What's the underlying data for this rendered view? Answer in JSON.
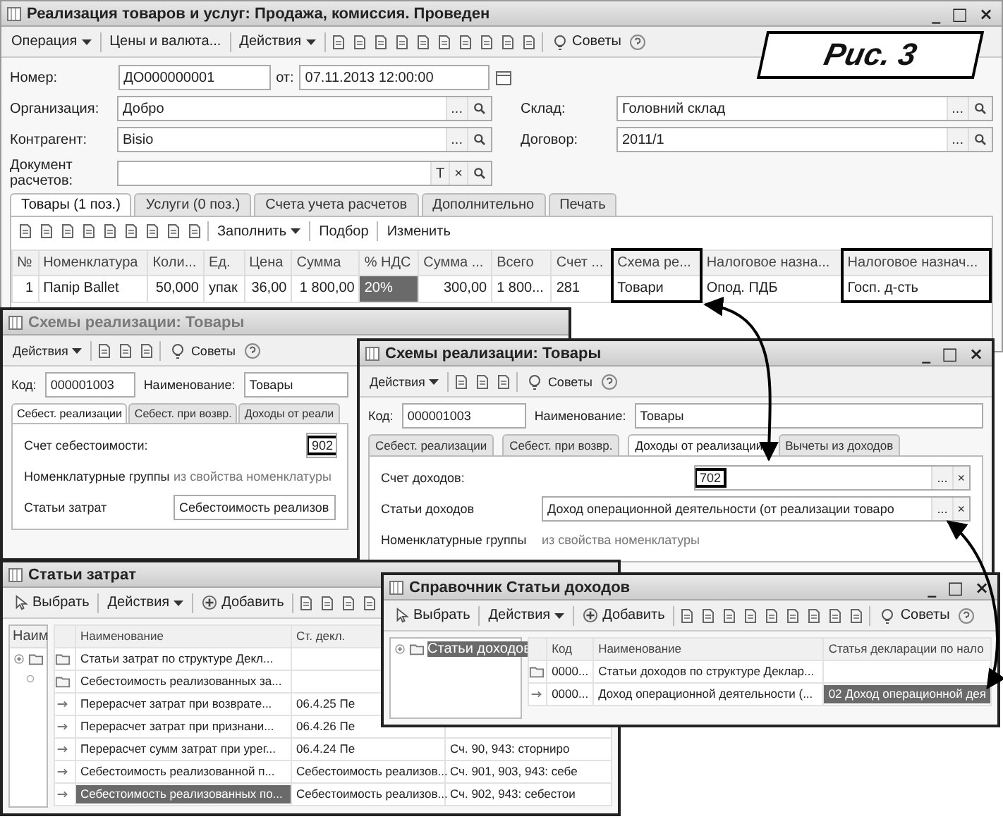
{
  "figure_label": "Рис. 3",
  "main_window": {
    "title": "Реализация товаров и услуг: Продажа, комиссия. Проведен",
    "active": true,
    "controls": [
      "_",
      "□",
      "×"
    ],
    "toolbar": [
      {
        "label": "Операция",
        "dropdown": true
      },
      {
        "label": "Цены и валюта...",
        "dropdown": false
      },
      {
        "label": "Действия",
        "dropdown": true
      }
    ],
    "tips": "Советы",
    "number": {
      "label": "Номер:",
      "value": "ДО000000001"
    },
    "date": {
      "label": "от:",
      "value": "07.11.2013 12:00:00"
    },
    "fields": [
      {
        "label": "Организация:",
        "value": "Добро",
        "buttons": [
          "..."
        ],
        "search": true
      },
      {
        "label": "Склад:",
        "value": "Головний склад",
        "buttons": [
          "..."
        ],
        "search": true
      },
      {
        "label": "Контрагент:",
        "value": "Bisio",
        "buttons": [
          "..."
        ],
        "search": true
      },
      {
        "label": "Договор:",
        "value": "2011/1",
        "buttons": [
          "..."
        ],
        "search": true
      },
      {
        "label": "Документ расчетов:",
        "buttons": [
          "T",
          "×"
        ],
        "search": true
      }
    ],
    "tabs": [
      {
        "label": "Товары (1 поз.)",
        "selected": true
      },
      {
        "label": "Услуги (0 поз.)",
        "selected": false
      },
      {
        "label": "Счета учета расчетов",
        "selected": false
      },
      {
        "label": "Дополнительно",
        "selected": false
      },
      {
        "label": "Печать",
        "selected": false
      }
    ],
    "table_toolbar": [
      {
        "label": "Заполнить",
        "dropdown": true
      },
      {
        "label": "Подбор",
        "dropdown": false
      },
      {
        "label": "Изменить",
        "dropdown": false
      }
    ],
    "table": {
      "columns": [
        {
          "label": "№",
          "highlighted": false
        },
        {
          "label": "Номенклатура",
          "highlighted": false
        },
        {
          "label": "Коли...",
          "highlighted": false
        },
        {
          "label": "Ед.",
          "highlighted": false
        },
        {
          "label": "Цена",
          "highlighted": false
        },
        {
          "label": "Сумма",
          "highlighted": false
        },
        {
          "label": "% НДС",
          "highlighted": false
        },
        {
          "label": "Сумма ...",
          "highlighted": false
        },
        {
          "label": "Всего",
          "highlighted": false
        },
        {
          "label": "Счет ...",
          "highlighted": false
        },
        {
          "label": "Схема ре...",
          "highlighted": true
        },
        {
          "label": "Налоговое назна...",
          "highlighted": false
        },
        {
          "label": "Налоговое назнач...",
          "highlighted": true
        }
      ],
      "rows": [
        {
          "cells": [
            {
              "text": "1",
              "selected": false
            },
            {
              "text": "Папір Ballet",
              "selected": false
            },
            {
              "text": "50,000",
              "selected": false
            },
            {
              "text": "упак",
              "selected": false
            },
            {
              "text": "36,00",
              "selected": false
            },
            {
              "text": "1 800,00",
              "selected": false
            },
            {
              "text": "20%",
              "selected": true
            },
            {
              "text": "300,00",
              "selected": false
            },
            {
              "text": "1 800...",
              "selected": false
            },
            {
              "text": "281",
              "selected": false
            },
            {
              "text": "Товари",
              "selected": false
            },
            {
              "text": "Опод. ПДБ",
              "selected": false
            },
            {
              "text": "Госп. д-сть",
              "selected": false
            }
          ]
        }
      ]
    }
  },
  "scheme_window_back": {
    "title": "Схемы реализации: Товары",
    "active": false,
    "toolbar": [
      {
        "label": "Действия",
        "dropdown": true
      }
    ],
    "tips": "Советы",
    "code": {
      "label": "Код:",
      "value": "000001003"
    },
    "name": {
      "label": "Наименование:",
      "value": "Товары"
    },
    "tabs": [
      {
        "label": "Себест. реализации",
        "selected": true
      },
      {
        "label": "Себест. при возвр.",
        "selected": false
      },
      {
        "label": "Доходы от реали",
        "selected": false
      }
    ],
    "rows": [
      {
        "kind": "account",
        "label": "Счет себестоимости:",
        "value": "902",
        "highlighted": true
      },
      {
        "kind": "text",
        "label": "Номенклатурные группы",
        "value": "из свойства номенклатуры"
      },
      {
        "kind": "field",
        "label": "Статьи затрат",
        "value": "Себестоимость реализов"
      }
    ]
  },
  "scheme_window_front": {
    "title": "Схемы реализации: Товары",
    "active": true,
    "controls": [
      "_",
      "□",
      "×"
    ],
    "toolbar": [
      {
        "label": "Действия",
        "dropdown": true
      }
    ],
    "tips": "Советы",
    "code": {
      "label": "Код:",
      "value": "000001003"
    },
    "name": {
      "label": "Наименование:",
      "value": "Товары"
    },
    "tabs": [
      {
        "label": "Себест. реализации",
        "selected": false
      },
      {
        "label": "Себест. при возвр.",
        "selected": false
      },
      {
        "label": "Доходы от реализации",
        "selected": true
      },
      {
        "label": "Вычеты из доходов",
        "selected": false
      }
    ],
    "rows": [
      {
        "kind": "account",
        "label": "Счет доходов:",
        "value": "702",
        "highlighted": true,
        "buttons": [
          "...",
          "×"
        ]
      },
      {
        "kind": "field",
        "label": "Статьи доходов",
        "value": "Доход операционной деятельности (от реализации товаро",
        "buttons": [
          "...",
          "×"
        ]
      },
      {
        "kind": "text",
        "label": "Номенклатурные группы",
        "value": "из свойства номенклатуры"
      }
    ]
  },
  "expense_window": {
    "title": "Статьи затрат",
    "active": true,
    "toolbar": [
      {
        "label": "Выбрать",
        "kind": "pick"
      },
      {
        "label": "Действия",
        "kind": "menu"
      },
      {
        "label": "Добавить",
        "kind": "add"
      }
    ],
    "tree_header": "Наим",
    "columns": [
      "Наименование",
      "Ст. декл."
    ],
    "rows": [
      {
        "kind": "group",
        "cells": [
          {
            "text": "Статьи затрат по структуре Декл...",
            "selected": false
          }
        ]
      },
      {
        "kind": "group",
        "cells": [
          {
            "text": "Себестоимость реализованных за...",
            "selected": false
          }
        ]
      },
      {
        "kind": "item",
        "cells": [
          {
            "text": "Перерасчет затрат при возврате...",
            "selected": false
          },
          {
            "text": "06.4.25 Пе",
            "selected": false
          }
        ]
      },
      {
        "kind": "item",
        "cells": [
          {
            "text": "Перерасчет затрат при признани...",
            "selected": false
          },
          {
            "text": "06.4.26 Пе",
            "selected": false
          }
        ]
      },
      {
        "kind": "item",
        "cells": [
          {
            "text": "Перерасчет сумм затрат при урег...",
            "selected": false
          },
          {
            "text": "06.4.24 Пе",
            "selected": false
          },
          {
            "text": "Сч. 90, 943: сторниро",
            "selected": false
          }
        ]
      },
      {
        "kind": "item",
        "cells": [
          {
            "text": "Себестоимость реализованной п...",
            "selected": false
          },
          {
            "text": "Себестоимость реализов...",
            "selected": false
          },
          {
            "text": "Сч. 901, 903, 943: себе",
            "selected": false
          }
        ]
      },
      {
        "kind": "item",
        "cells": [
          {
            "text": "Себестоимость реализованных по...",
            "selected": true
          },
          {
            "text": "Себестоимость реализов...",
            "selected": false
          },
          {
            "text": "Сч. 902, 943: себестои",
            "selected": false
          }
        ]
      }
    ]
  },
  "income_window": {
    "title": "Справочник Статьи доходов",
    "active": true,
    "controls": [
      "_",
      "□",
      "×"
    ],
    "toolbar": [
      {
        "label": "Выбрать",
        "kind": "pick"
      },
      {
        "label": "Действия",
        "kind": "menu"
      },
      {
        "label": "Добавить",
        "kind": "add"
      }
    ],
    "tips": "Советы",
    "tree": [
      {
        "label": "Статьи доходов",
        "selected": true
      }
    ],
    "columns": [
      "Код",
      "Наименование",
      "Статья декларации по нало"
    ],
    "rows": [
      {
        "kind": "group",
        "cells": [
          {
            "text": "0000...",
            "selected": false
          },
          {
            "text": "Статьи доходов по структуре Деклар...",
            "selected": false
          }
        ]
      },
      {
        "kind": "item",
        "cells": [
          {
            "text": "0000...",
            "selected": false
          },
          {
            "text": "Доход операционной деятельности (...",
            "selected": false
          },
          {
            "text": "02 Доход операционной дея",
            "selected": true
          }
        ]
      }
    ]
  }
}
